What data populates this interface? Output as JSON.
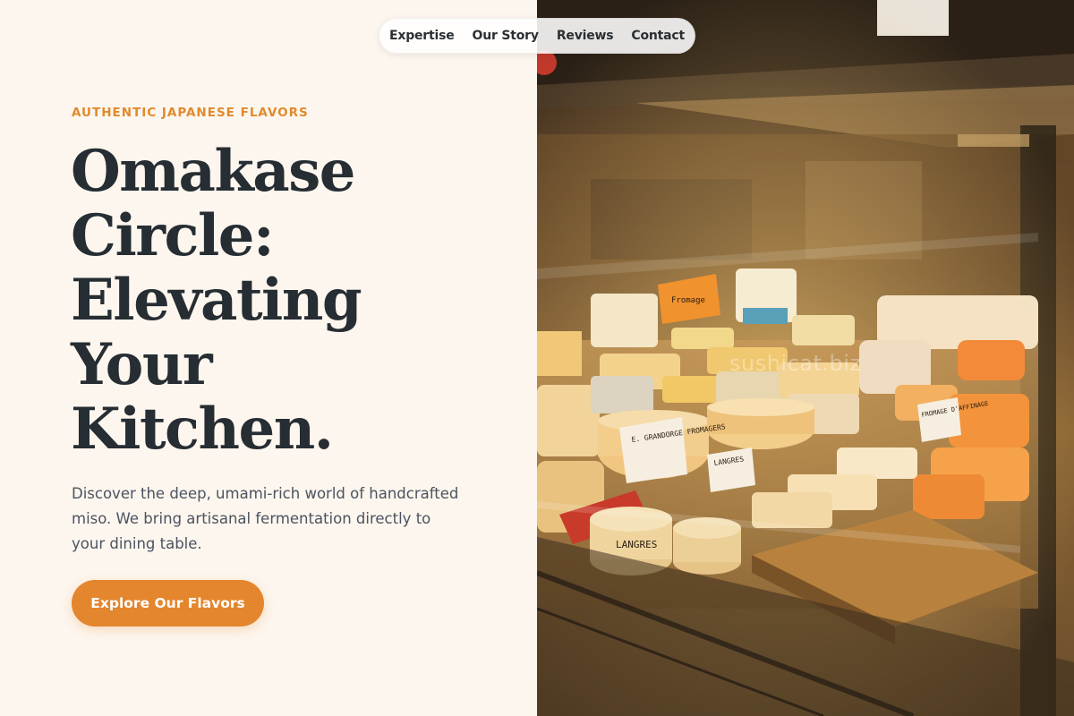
{
  "nav": {
    "items": [
      {
        "label": "Expertise"
      },
      {
        "label": "Our Story"
      },
      {
        "label": "Reviews"
      },
      {
        "label": "Contact"
      }
    ]
  },
  "hero": {
    "eyebrow": "AUTHENTIC JAPANESE FLAVORS",
    "headline_lines": [
      "Omakase",
      "Circle:",
      "Elevating",
      "Your",
      "Kitchen."
    ],
    "description": "Discover the deep, umami-rich world of handcrafted miso. We bring artisanal fermentation directly to your dining table.",
    "cta_label": "Explore Our Flavors"
  },
  "photo": {
    "watermark": "sushicat.biz",
    "labels": {
      "grandorge": "E. GRANDORGE FROMAGERS",
      "langres": "LANGRES",
      "langres_box": "LANGRES",
      "right_tag": "FROMAGE D'AFFINAGE",
      "orange_tag": "Fromage"
    }
  },
  "colors": {
    "accent": "#e3862e",
    "eyebrow": "#e08a2e",
    "heading": "#262d33",
    "body_text": "#4b5360",
    "background": "#fdf6ee"
  }
}
